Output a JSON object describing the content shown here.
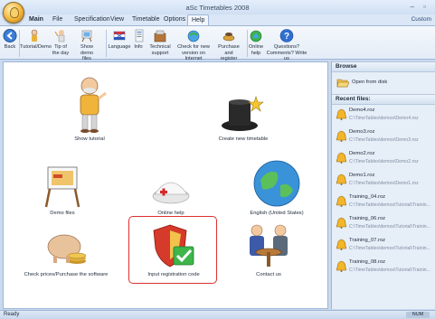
{
  "window": {
    "title": "aSc Timetables 2008",
    "controls": "– ▫"
  },
  "menu": {
    "items": [
      "Main",
      "File",
      "Specification",
      "View",
      "Timetable",
      "Options",
      "Help"
    ],
    "active": "Help",
    "right_link": "Custom"
  },
  "ribbon": {
    "buttons": [
      {
        "label1": "Back",
        "label2": "",
        "icon": "back-arrow-icon"
      },
      {
        "label1": "Tutorial/Demo",
        "label2": "",
        "icon": "tutorial-icon"
      },
      {
        "label1": "Tip of",
        "label2": "the day",
        "icon": "tip-icon"
      },
      {
        "label1": "Show demo",
        "label2": "files",
        "icon": "demo-files-icon"
      },
      {
        "label1": "Language",
        "label2": "",
        "icon": "language-flag-icon"
      },
      {
        "label1": "Info",
        "label2": "",
        "icon": "info-icon"
      },
      {
        "label1": "Technical",
        "label2": "support",
        "icon": "support-icon"
      },
      {
        "label1": "Check for new",
        "label2": "version on Internet",
        "icon": "update-icon"
      },
      {
        "label1": "Purchase and",
        "label2": "register",
        "icon": "purchase-icon"
      },
      {
        "label1": "Online",
        "label2": "help",
        "icon": "online-help-icon"
      },
      {
        "label1": "Questions?",
        "label2": "Comments? Write us",
        "icon": "question-icon"
      }
    ]
  },
  "tiles": [
    {
      "caption": "Show tutorial",
      "icon": "tutorial-man-icon"
    },
    {
      "caption": "Create new timetable",
      "icon": "magic-hat-icon"
    },
    {
      "caption": "Demo files",
      "icon": "demo-easel-icon"
    },
    {
      "caption": "Online help",
      "icon": "nurse-hat-icon"
    },
    {
      "caption": "English (United States)",
      "icon": "globe-icon"
    },
    {
      "caption": "Check prices/Purchase the software",
      "icon": "piggy-bank-icon"
    },
    {
      "caption": "Input registration code",
      "icon": "shield-check-icon"
    },
    {
      "caption": "Contact us",
      "icon": "people-table-icon"
    }
  ],
  "sidebar": {
    "browse_header": "Browse",
    "open_label": "Open from disk",
    "recent_header": "Recent files:",
    "recent": [
      {
        "name": "Demo4.roz",
        "path": "C:\\TimeTables\\demos\\Demo4.roz"
      },
      {
        "name": "Demo3.roz",
        "path": "C:\\TimeTables\\demos\\Demo3.roz"
      },
      {
        "name": "Demo2.roz",
        "path": "C:\\TimeTables\\demos\\Demo2.roz"
      },
      {
        "name": "Demo1.roz",
        "path": "C:\\TimeTables\\demos\\Demo1.roz"
      },
      {
        "name": "Training_04.roz",
        "path": "C:\\TimeTables\\demos\\Tutorial\\Trainin..."
      },
      {
        "name": "Training_06.roz",
        "path": "C:\\TimeTables\\demos\\Tutorial\\Trainin..."
      },
      {
        "name": "Training_07.roz",
        "path": "C:\\TimeTables\\demos\\Tutorial\\Trainin..."
      },
      {
        "name": "Training_08.roz",
        "path": "C:\\TimeTables\\demos\\Tutorial\\Trainin..."
      }
    ]
  },
  "status": {
    "text": "Ready",
    "indicator": "NUM"
  },
  "colors": {
    "highlight": "#e03030",
    "ribbon_bg": "#e3ecf7",
    "accent": "#2c4a7a"
  }
}
